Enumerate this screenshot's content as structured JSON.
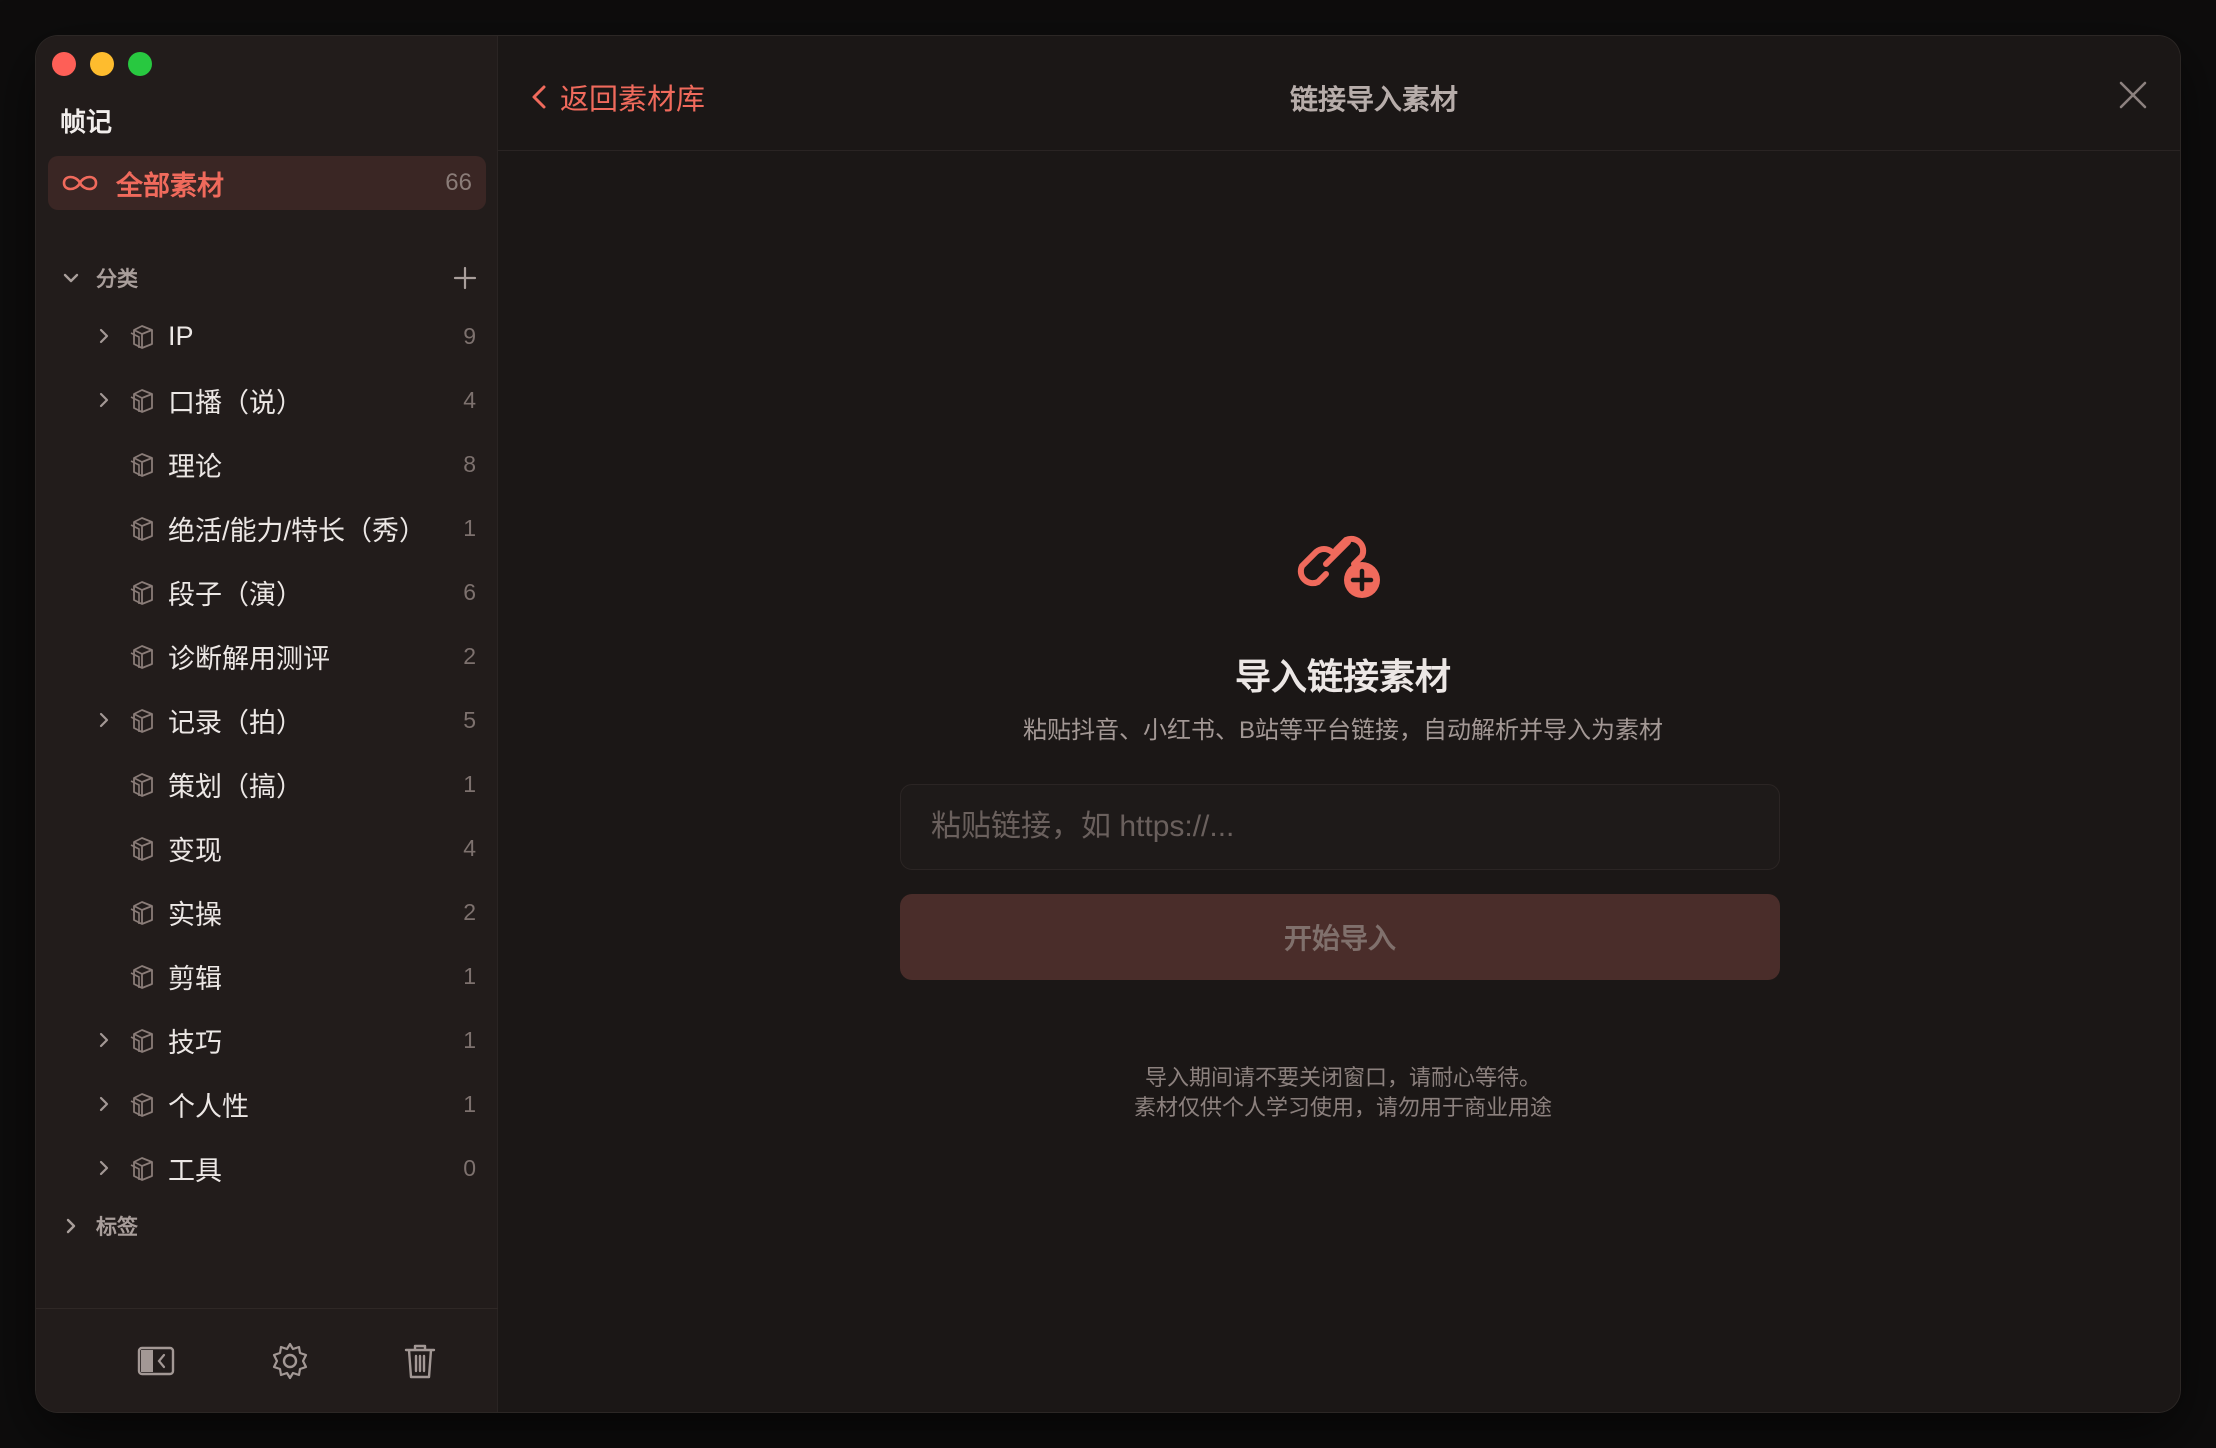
{
  "app": {
    "title": "帧记"
  },
  "sidebar": {
    "all": {
      "label": "全部素材",
      "count": "66",
      "icon": "infinity-icon"
    },
    "categories_section": {
      "label": "分类",
      "add_icon": "plus-icon"
    },
    "categories": [
      {
        "label": "IP",
        "count": "9",
        "expandable": true
      },
      {
        "label": "口播（说）",
        "count": "4",
        "expandable": true
      },
      {
        "label": "理论",
        "count": "8",
        "expandable": false
      },
      {
        "label": "绝活/能力/特长（秀）",
        "count": "1",
        "expandable": false
      },
      {
        "label": "段子（演）",
        "count": "6",
        "expandable": false
      },
      {
        "label": "诊断解用测评",
        "count": "2",
        "expandable": false
      },
      {
        "label": "记录（拍）",
        "count": "5",
        "expandable": true
      },
      {
        "label": "策划（搞）",
        "count": "1",
        "expandable": false
      },
      {
        "label": "变现",
        "count": "4",
        "expandable": false
      },
      {
        "label": "实操",
        "count": "2",
        "expandable": false
      },
      {
        "label": "剪辑",
        "count": "1",
        "expandable": false
      },
      {
        "label": "技巧",
        "count": "1",
        "expandable": true
      },
      {
        "label": "个人性",
        "count": "1",
        "expandable": true
      },
      {
        "label": "工具",
        "count": "0",
        "expandable": true
      }
    ],
    "tags_section": {
      "label": "标签"
    },
    "bottom_icons": [
      "sidebar-toggle-icon",
      "gear-icon",
      "trash-icon"
    ]
  },
  "header": {
    "back_label": "返回素材库",
    "title": "链接导入素材",
    "close_icon": "close-icon"
  },
  "import": {
    "icon": "link-add-icon",
    "heading": "导入链接素材",
    "subtitle": "粘贴抖音、小红书、B站等平台链接，自动解析并导入为素材",
    "input_placeholder": "粘贴链接，如 https://...",
    "input_value": "",
    "button_label": "开始导入",
    "note_line1": "导入期间请不要关闭窗口，请耐心等待。",
    "note_line2": "素材仅供个人学习使用，请勿用于商业用途"
  },
  "colors": {
    "accent": "#f06a5c",
    "window_bg": "#1b1716",
    "sidebar_bg": "#221c1b",
    "selected_bg": "#3a2624",
    "button_disabled_bg": "#4a2d2a"
  }
}
